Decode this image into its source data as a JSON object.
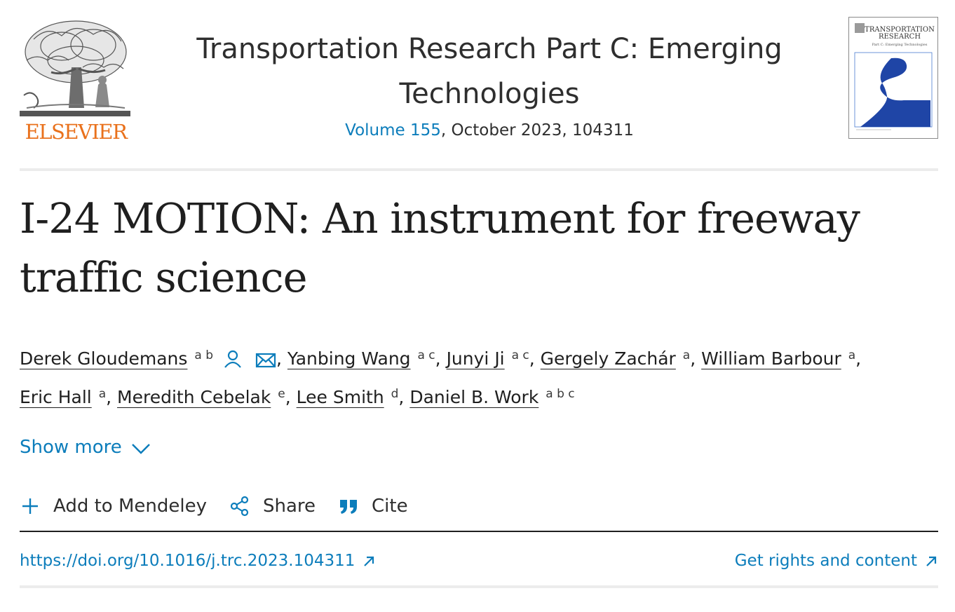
{
  "publisher": {
    "logo_text": "ELSEVIER",
    "color": "#e9711c"
  },
  "journal": {
    "title": "Transportation Research Part C: Emerging Technologies",
    "volume_link": "Volume 155",
    "issue_info": ", October 2023, 104311"
  },
  "cover": {
    "title_line1": "TRANSPORTATION",
    "title_line2": "RESEARCH",
    "subtitle": "Part C: Emerging Technologies"
  },
  "article": {
    "title": "I-24 MOTION: An instrument for freeway traffic science"
  },
  "authors": [
    {
      "name": "Derek Gloudemans",
      "affil": "a b"
    },
    {
      "name": "Yanbing Wang",
      "affil": "a c"
    },
    {
      "name": "Junyi Ji",
      "affil": "a c"
    },
    {
      "name": "Gergely Zachár",
      "affil": "a"
    },
    {
      "name": "William Barbour",
      "affil": "a"
    },
    {
      "name": "Eric Hall",
      "affil": "a"
    },
    {
      "name": "Meredith Cebelak",
      "affil": "e"
    },
    {
      "name": "Lee Smith",
      "affil": "d"
    },
    {
      "name": "Daniel B. Work",
      "affil": "a b c"
    }
  ],
  "show_more": "Show more",
  "actions": {
    "mendeley": "Add to Mendeley",
    "share": "Share",
    "cite": "Cite"
  },
  "doi": "https://doi.org/10.1016/j.trc.2023.104311",
  "rights": "Get rights and content",
  "colors": {
    "link": "#0c7dbb",
    "text": "#1f1f1f"
  }
}
